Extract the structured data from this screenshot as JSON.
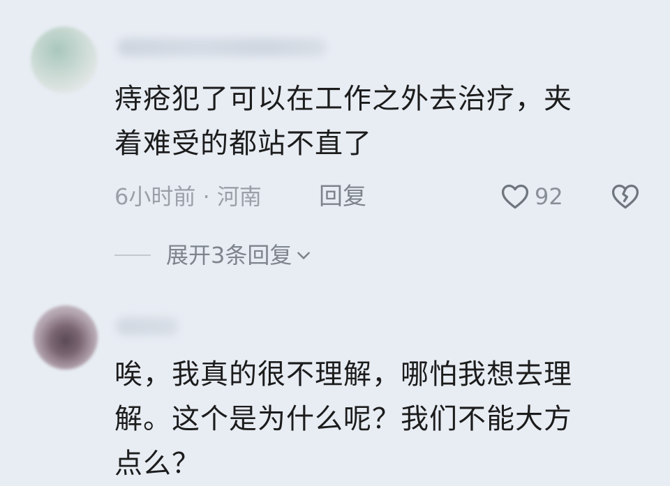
{
  "comments": [
    {
      "text_line1": "痔疮犯了可以在工作之外去治疗，夹",
      "text_line2": "着难受的都站不直了",
      "meta": "6小时前 · 河南",
      "reply_label": "回复",
      "likes": "92",
      "expand_label": "展开3条回复"
    },
    {
      "text_line1": "唉，我真的很不理解，哪怕我想去理",
      "text_line2": "解。这个是为什么呢？我们不能大方",
      "text_line3": "点么？"
    }
  ],
  "icons": {
    "like": "heart-outline-icon",
    "dislike": "broken-heart-icon",
    "expand": "chevron-down-icon"
  },
  "colors": {
    "background": "#e8edf4",
    "text": "#1c1c1c",
    "meta": "#9aa0a7"
  }
}
